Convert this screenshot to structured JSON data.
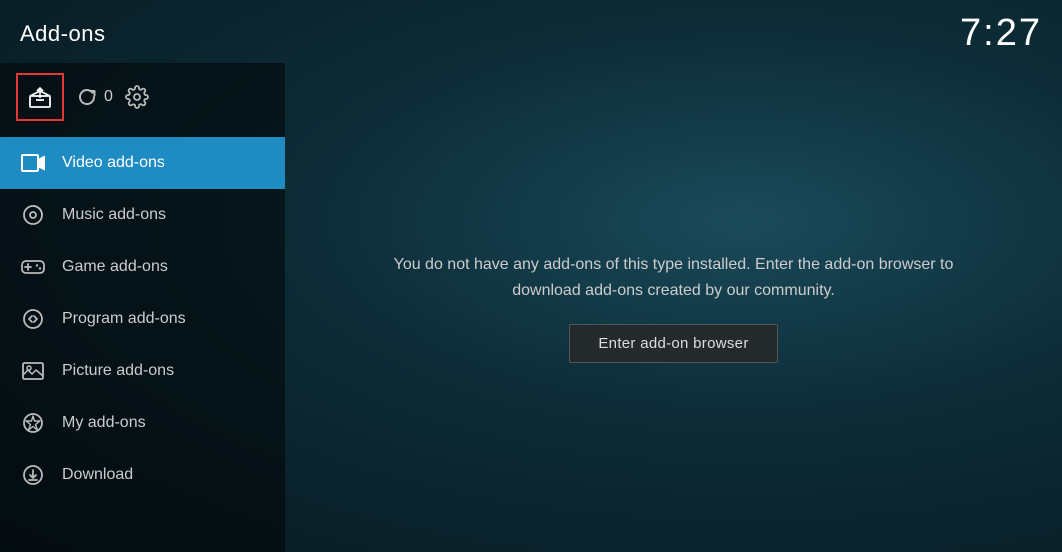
{
  "header": {
    "title": "Add-ons",
    "time": "7:27"
  },
  "toolbar": {
    "addon_box_label": "Add-on box",
    "refresh_count": "0",
    "settings_label": "Settings"
  },
  "nav": {
    "items": [
      {
        "id": "video-addons",
        "label": "Video add-ons",
        "active": true,
        "icon": "video-icon"
      },
      {
        "id": "music-addons",
        "label": "Music add-ons",
        "active": false,
        "icon": "music-icon"
      },
      {
        "id": "game-addons",
        "label": "Game add-ons",
        "active": false,
        "icon": "game-icon"
      },
      {
        "id": "program-addons",
        "label": "Program add-ons",
        "active": false,
        "icon": "program-icon"
      },
      {
        "id": "picture-addons",
        "label": "Picture add-ons",
        "active": false,
        "icon": "picture-icon"
      },
      {
        "id": "my-addons",
        "label": "My add-ons",
        "active": false,
        "icon": "my-addons-icon"
      },
      {
        "id": "download",
        "label": "Download",
        "active": false,
        "icon": "download-icon"
      }
    ]
  },
  "content": {
    "empty_message": "You do not have any add-ons of this type installed. Enter the add-on browser to download add-ons created by our community.",
    "enter_browser_label": "Enter add-on browser"
  }
}
